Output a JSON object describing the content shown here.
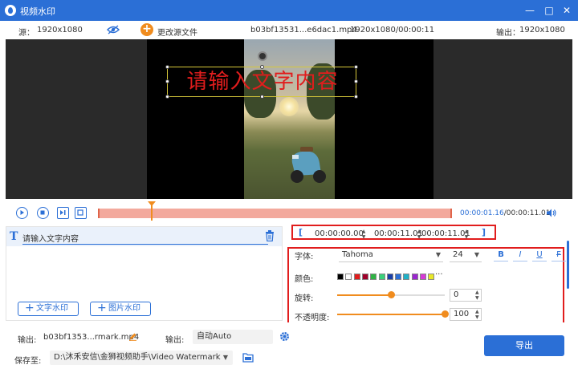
{
  "window": {
    "title": "视频水印",
    "icons": [
      "app-drop-icon",
      "minimize-icon",
      "maximize-icon",
      "close-icon"
    ]
  },
  "infobar": {
    "source_label": "源：",
    "source_res": "1920x1080",
    "change_source_label": "更改源文件",
    "file_name": "b03bf13531...e6dac1.mp4",
    "file_info": "1920x1080/00:00:11",
    "output_label": "输出：",
    "output_res": "1920x1080"
  },
  "preview": {
    "watermark_text": "请输入文字内容",
    "watermark_color": "#e11d1d"
  },
  "timeline": {
    "current_time": "00:00:01.16",
    "total_time": "/00:00:11.01"
  },
  "watermark_list": {
    "items": [
      {
        "label": "请输入文字内容"
      }
    ],
    "add_text_label": "文字水印",
    "add_image_label": "图片水印"
  },
  "range": {
    "open_bracket": "[",
    "close_bracket": "]",
    "start": "00:00:00.00",
    "end": "00:00:11.01",
    "duration": "00:00:11.01"
  },
  "text_settings": {
    "font_label": "字体:",
    "font_value": "Tahoma",
    "size_value": "24",
    "bold": "B",
    "italic": "I",
    "underline": "U",
    "strike": "F",
    "color_label": "颜色:",
    "colors": [
      "#000000",
      "#ffffff",
      "#e11d1d",
      "#a0002a",
      "#2fb344",
      "#3ad17a",
      "#1a3fa8",
      "#2b6fd6",
      "#20b2c8",
      "#9b27d0",
      "#d63ad6",
      "#e8e829"
    ],
    "more_colors": "···",
    "rotation_label": "旋转:",
    "rotation_value": "0",
    "rotation_fraction": 0.5,
    "opacity_label": "不透明度:",
    "opacity_value": "100",
    "opacity_fraction": 1.0
  },
  "bottom": {
    "output_label": "输出:",
    "output_file": "b03bf1353...rmark.mp4",
    "format_label": "输出:",
    "format_value": "自动Auto",
    "save_label": "保存至:",
    "save_path": "D:\\沐禾安信\\金狮视频助手\\Video Watermark",
    "export_label": "导出"
  }
}
